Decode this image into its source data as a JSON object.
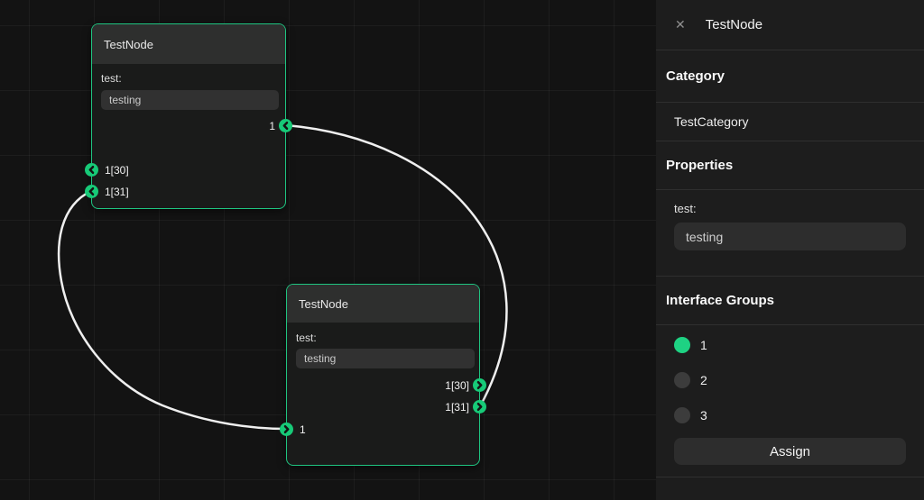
{
  "colors": {
    "accent_green": "#1ed283",
    "node_border_green": "#1fc581",
    "port_green": "#17ca78",
    "wire_white": "#efefef",
    "canvas_bg": "#131313",
    "sidebar_bg": "#1d1d1d"
  },
  "canvas": {
    "nodes": [
      {
        "title": "TestNode",
        "field_label": "test:",
        "field_value": "testing",
        "output_ports": [
          "1"
        ],
        "input_ports": [
          "1[30]",
          "1[31]"
        ]
      },
      {
        "title": "TestNode",
        "field_label": "test:",
        "field_value": "testing",
        "output_ports": [
          "1[30]",
          "1[31]"
        ],
        "input_ports": [
          "1"
        ]
      }
    ]
  },
  "sidebar": {
    "close_icon": "✕",
    "title": "TestNode",
    "category": {
      "heading": "Category",
      "value": "TestCategory"
    },
    "properties": {
      "heading": "Properties",
      "field_label": "test:",
      "field_value": "testing"
    },
    "interface_groups": {
      "heading": "Interface Groups",
      "options": [
        {
          "label": "1",
          "selected": true
        },
        {
          "label": "2",
          "selected": false
        },
        {
          "label": "3",
          "selected": false
        }
      ],
      "assign_label": "Assign"
    }
  }
}
